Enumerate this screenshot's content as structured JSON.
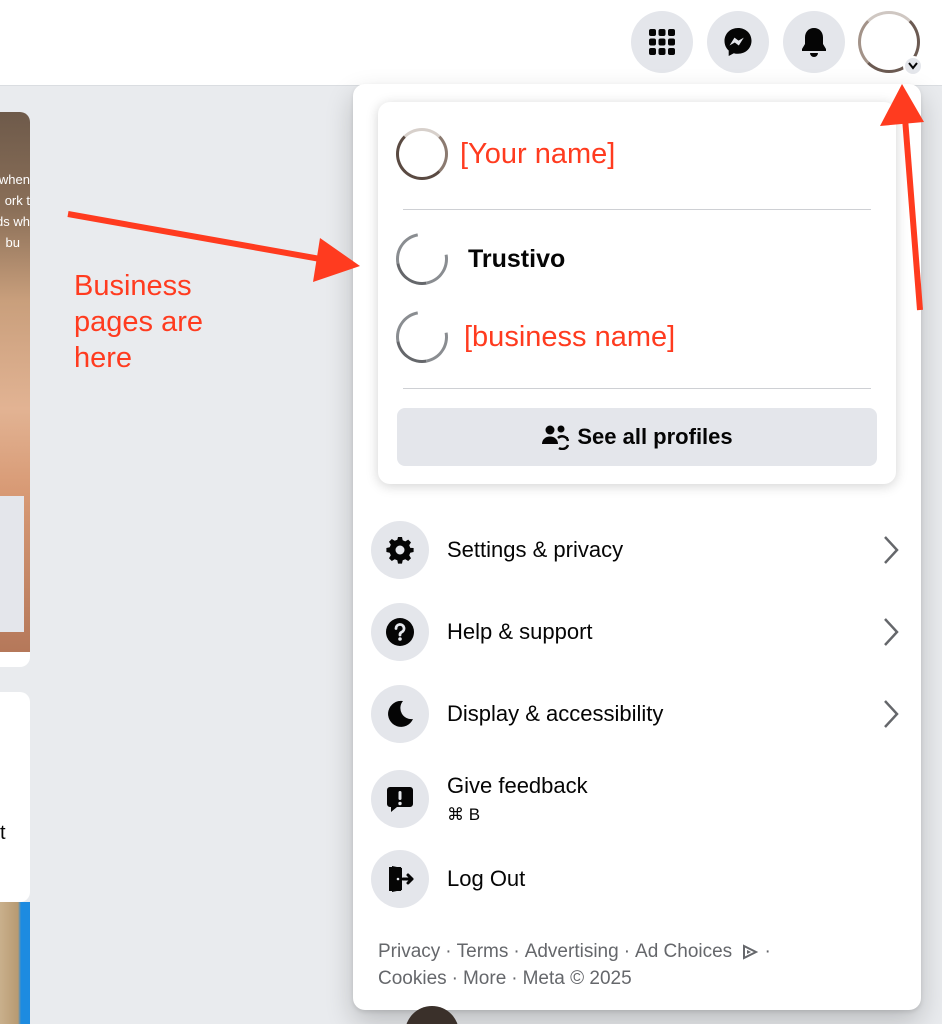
{
  "topbar": {
    "menu_button": "menu-grid-icon",
    "messenger_button": "messenger-icon",
    "notifications_button": "bell-icon",
    "account_button": "avatar"
  },
  "background_feed": {
    "post_snippet": [
      "when",
      "ork t",
      "ds wh",
      "bu"
    ],
    "side_text": "t"
  },
  "annotation": {
    "text_line1": "Business",
    "text_line2": "pages are",
    "text_line3": "here",
    "color": "#ff3b1f"
  },
  "profiles": {
    "current_user": "[Your name]",
    "pages": [
      {
        "name": "Trustivo"
      },
      {
        "name": "[business name]"
      }
    ],
    "see_all_label": "See all profiles"
  },
  "menu": {
    "items": [
      {
        "label": "Settings & privacy",
        "icon": "gear-icon",
        "has_chevron": true
      },
      {
        "label": "Help & support",
        "icon": "question-icon",
        "has_chevron": true
      },
      {
        "label": "Display & accessibility",
        "icon": "moon-icon",
        "has_chevron": true
      },
      {
        "label": "Give feedback",
        "sublabel": "⌘ B",
        "icon": "feedback-icon",
        "has_chevron": false
      },
      {
        "label": "Log Out",
        "icon": "logout-icon",
        "has_chevron": false
      }
    ]
  },
  "footer": {
    "privacy": "Privacy",
    "terms": "Terms",
    "advertising": "Advertising",
    "ad_choices": "Ad Choices",
    "cookies": "Cookies",
    "more": "More",
    "copyright": "Meta © 2025"
  },
  "colors": {
    "page_bg": "#e9ebee",
    "button_bg": "#e4e6eb",
    "annotation_red": "#ff3b1f",
    "text_primary": "#050505",
    "text_secondary": "#65676b"
  }
}
